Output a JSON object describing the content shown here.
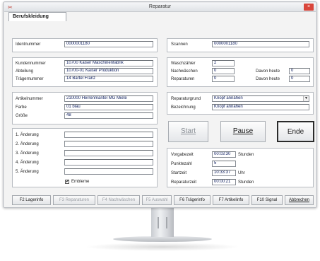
{
  "window": {
    "title": "Reparatur",
    "close_glyph": "×"
  },
  "tabs": [
    {
      "label": "Berufskleidung"
    }
  ],
  "article_panel": {
    "identnummer": {
      "label": "Identnummer",
      "value": "0000001180"
    }
  },
  "customer_panel": {
    "kundennummer": {
      "label": "Kundennummer",
      "value": "10700  Kaiser Maschinenfabrik"
    },
    "abteilung": {
      "label": "Abteilung",
      "value": "10700-01  Kaiser Produktion"
    },
    "traegernummer": {
      "label": "Trägernummer",
      "value": "14  Bartel Franz"
    }
  },
  "item_panel": {
    "artikelnummer": {
      "label": "Artikelnummer",
      "value": "210000  Herrenmantel MG Miete"
    },
    "farbe": {
      "label": "Farbe",
      "value": "01  blau"
    },
    "groesse": {
      "label": "Größe",
      "value": "48"
    }
  },
  "changes_panel": {
    "items": [
      {
        "label": "1. Änderung",
        "value": ""
      },
      {
        "label": "2. Änderung",
        "value": ""
      },
      {
        "label": "3. Änderung",
        "value": ""
      },
      {
        "label": "4. Änderung",
        "value": ""
      },
      {
        "label": "5. Änderung",
        "value": ""
      }
    ],
    "embleme": {
      "label": "Embleme",
      "checked": true,
      "glyph": "✔"
    }
  },
  "scan_panel": {
    "scannen": {
      "label": "Scannen",
      "value": "0000001180"
    }
  },
  "counts_panel": {
    "waschzaehler": {
      "label": "Waschzähler",
      "value": "2"
    },
    "nachwaeschen": {
      "label": "Nachwäschen",
      "value": "0"
    },
    "reparaturen": {
      "label": "Reparaturen",
      "value": "0"
    },
    "davon_heute_1": {
      "label": "Davon heute",
      "value": "0"
    },
    "davon_heute_2": {
      "label": "Davon heute",
      "value": "0"
    }
  },
  "repair_panel": {
    "reparaturgrund": {
      "label": "Reparaturgrund",
      "value": "Knopf annähen"
    },
    "bezeichnung": {
      "label": "Bezeichnung",
      "value": "Knopf annähen"
    }
  },
  "actions": {
    "start": "Start",
    "pause": "Pause",
    "ende": "Ende"
  },
  "time_panel": {
    "vorgabezeit": {
      "label": "Vorgabezeit",
      "value": "00:03:30",
      "unit": "Stunden"
    },
    "punktezahl": {
      "label": "Punktezahl",
      "value": "5"
    },
    "startzeit": {
      "label": "Startzeit",
      "value": "10:33:37",
      "unit": "Uhr"
    },
    "reparaturzeit": {
      "label": "Reparaturzeit",
      "value": "00:00:21",
      "unit": "Stunden"
    }
  },
  "function_keys": [
    {
      "label": "F2 Lagerinfo",
      "enabled": true
    },
    {
      "label": "F3 Reparaturen",
      "enabled": false
    },
    {
      "label": "F4 Nachwäschen",
      "enabled": false
    },
    {
      "label": "F5 Auswahl",
      "enabled": false
    },
    {
      "label": "F6 Trägerinfo",
      "enabled": true
    },
    {
      "label": "F7 Artikelinfo",
      "enabled": true
    },
    {
      "label": "F10 Signal",
      "enabled": true
    },
    {
      "label": "Abbrechen",
      "enabled": true
    }
  ],
  "colors": {
    "close": "#d9463b",
    "field_text": "#102060"
  }
}
